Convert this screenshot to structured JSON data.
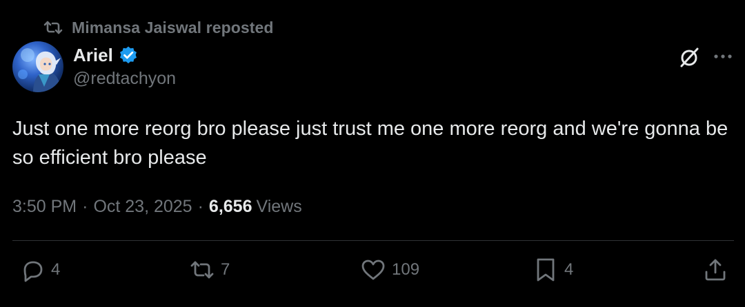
{
  "repost": {
    "label": "Mimansa Jaiswal reposted"
  },
  "author": {
    "display_name": "Ariel",
    "handle": "@redtachyon",
    "verified": true
  },
  "tweet": {
    "text": "Just one more reorg bro please just trust me one more reorg and we're gonna be so efficient bro please",
    "time": "3:50 PM",
    "separator": "·",
    "date": "Oct 23, 2025",
    "views_count": "6,656",
    "views_label": "Views"
  },
  "actions": {
    "replies": "4",
    "reposts": "7",
    "likes": "109",
    "bookmarks": "4"
  },
  "colors": {
    "background": "#000000",
    "text_primary": "#e7e9ea",
    "text_secondary": "#71767b",
    "verified_blue": "#1d9bf0",
    "divider": "#2f3336"
  },
  "icons": {
    "repost": "repost-icon",
    "verified": "verified-badge-icon",
    "grok": "grok-icon",
    "more": "more-dots-icon",
    "reply": "reply-icon",
    "retweet": "retweet-icon",
    "like": "heart-icon",
    "bookmark": "bookmark-icon",
    "share": "share-icon"
  }
}
